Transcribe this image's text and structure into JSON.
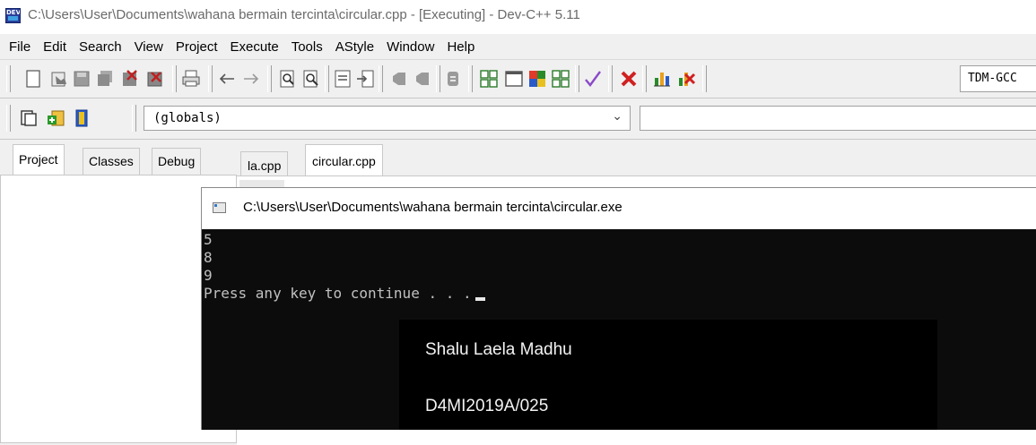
{
  "window": {
    "title": "C:\\Users\\User\\Documents\\wahana bermain tercinta\\circular.cpp - [Executing] - Dev-C++ 5.11",
    "app_icon_text": "DEV"
  },
  "menu": [
    "File",
    "Edit",
    "Search",
    "View",
    "Project",
    "Execute",
    "Tools",
    "AStyle",
    "Window",
    "Help"
  ],
  "toolbar": {
    "compiler_select": "TDM-GCC",
    "globals_select": "(globals)",
    "icons": [
      "new-file-icon",
      "open-file-icon",
      "save-icon",
      "save-all-icon",
      "close-file-icon",
      "close-all-icon",
      "print-icon",
      "undo-icon",
      "redo-icon",
      "find-icon",
      "replace-icon",
      "goto-line-icon",
      "indent-icon",
      "compile-icon",
      "run-icon",
      "compile-run-icon",
      "rebuild-icon",
      "debug-icon",
      "stop-icon",
      "profile-icon",
      "delete-profile-icon",
      "new-project-icon",
      "add-file-icon",
      "project-options-icon"
    ]
  },
  "left_panel": {
    "tabs": [
      "Project",
      "Classes",
      "Debug"
    ],
    "active_tab": "Project"
  },
  "editor": {
    "tabs": [
      "la.cpp",
      "circular.cpp"
    ],
    "active_tab": "circular.cpp"
  },
  "console": {
    "title": "C:\\Users\\User\\Documents\\wahana bermain tercinta\\circular.exe",
    "lines": [
      "5",
      "8",
      "9",
      "Press any key to continue . . ."
    ]
  },
  "watermark": {
    "name": "Shalu Laela Madhu",
    "id": "D4MI2019A/025"
  },
  "colors": {
    "console_bg": "#0c0c0c",
    "console_text": "#c0c0c0",
    "chrome_bg": "#f0f0f0"
  }
}
